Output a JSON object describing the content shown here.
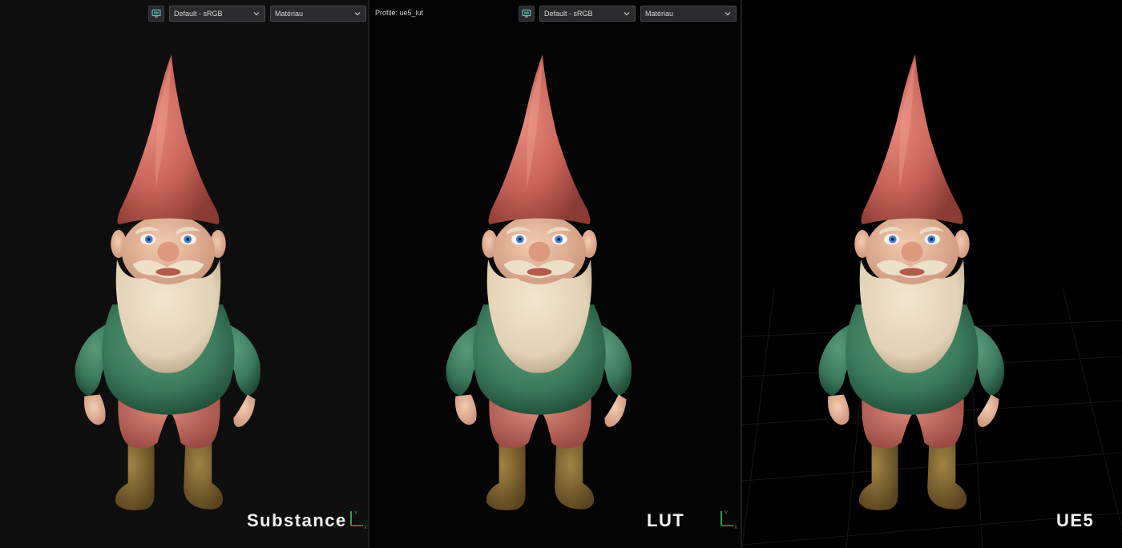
{
  "viewports": [
    {
      "caption": "Substance",
      "toolbar": {
        "display_profile": "Default - sRGB",
        "channel": "Matériau"
      },
      "axis": {
        "y": "Y",
        "x": "X"
      }
    },
    {
      "caption": "LUT",
      "profile_label": "Profile: ue5_lut",
      "toolbar": {
        "display_profile": "Default - sRGB",
        "channel": "Matériau"
      },
      "axis": {
        "y": "Y",
        "x": "X"
      }
    },
    {
      "caption": "UE5"
    }
  ],
  "colors": {
    "hat": "#c9645a",
    "beard": "#e2d2b6",
    "sweater": "#3c7a5c",
    "pants": "#c0675c",
    "boots": "#7a5f2c",
    "skin": "#e6b89a",
    "eyes": "#4c7fc4",
    "axis_y": "#39c06a",
    "axis_x": "#d8484c"
  },
  "icons": {
    "display_icon": "monitor-icon",
    "dropdown_icon": "chevron-down-icon"
  }
}
